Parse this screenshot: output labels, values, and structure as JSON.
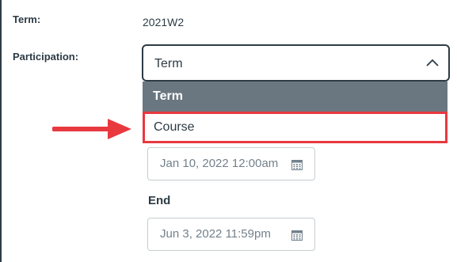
{
  "term": {
    "label": "Term:",
    "value": "2021W2"
  },
  "participation": {
    "label": "Participation:",
    "selected": "Term",
    "options": [
      "Term",
      "Course"
    ]
  },
  "dates": {
    "start_value": "Jan 10, 2022 12:00am",
    "end_label": "End",
    "end_value": "Jun 3, 2022 11:59pm"
  },
  "colors": {
    "highlight": "#e8393f",
    "option_highlight_bg": "#6b7780",
    "text": "#2d3b45"
  },
  "icons": {
    "dropdown": "chevron-up-icon",
    "date": "calendar-icon",
    "annotation": "red-arrow-icon"
  }
}
